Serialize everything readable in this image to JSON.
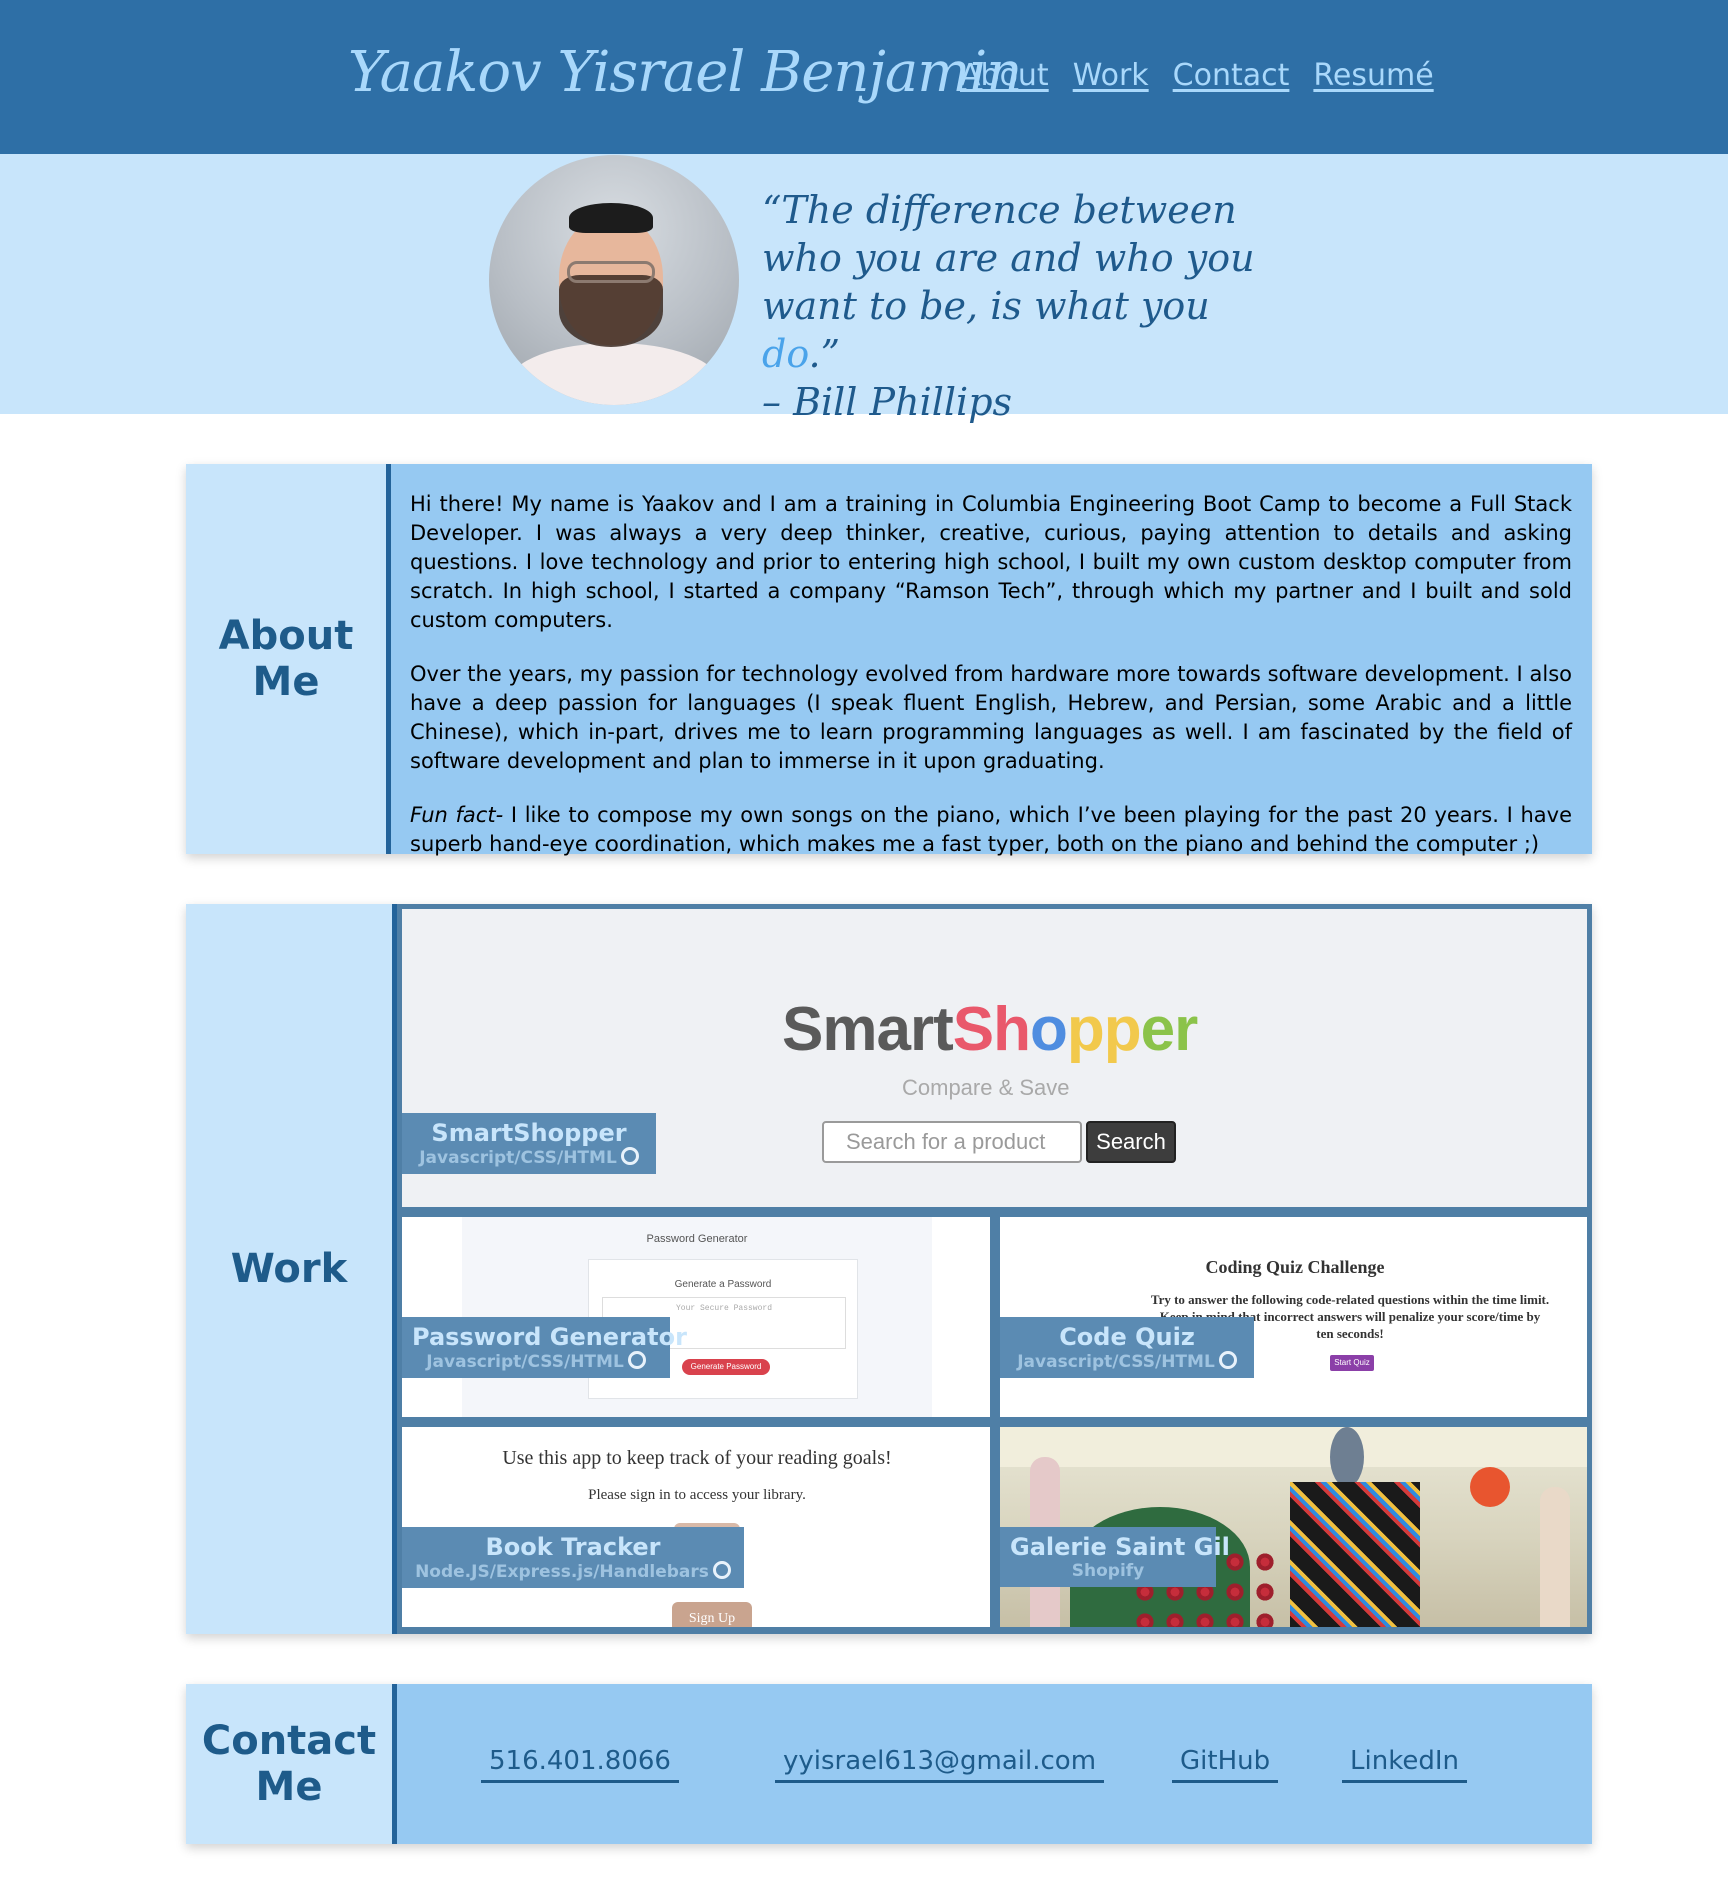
{
  "header": {
    "site_name": "Yaakov Yisrael Benjamin",
    "nav": [
      "About",
      "Work",
      "Contact",
      "Resumé"
    ]
  },
  "hero": {
    "quote_part1": "“The difference between who you are and who you want to be, is what you ",
    "quote_accent": "do",
    "quote_part2": ".”",
    "quote_author": "– Bill Phillips",
    "accent_color": "#4aa3ea"
  },
  "about": {
    "label_line1": "About",
    "label_line2": "Me",
    "para1": "Hi there! My name is Yaakov and I am a training in Columbia Engineering Boot Camp to become a Full Stack Developer. I was always a very deep thinker, creative, curious, paying attention to details and asking questions. I love technology and prior to entering high school, I built my own custom desktop computer from scratch. In high school, I started a company “Ramson Tech”, through which my partner and I built and sold custom computers.",
    "para2": "Over the years, my passion for technology evolved from hardware more towards software development. I also have a deep passion for languages (I speak fluent English, Hebrew, and Persian, some Arabic and a little Chinese), which in-part, drives me to learn programming languages as well. I am fascinated by the field of software development and plan to immerse in it upon graduating.",
    "para3_em": "Fun fact-",
    "para3_rest": " I like to compose my own songs on the piano, which I’ve been playing for the past 20 years. I have superb hand-eye coordination, which makes me a fast typer, both on the piano and behind the computer ;)"
  },
  "work": {
    "label": "Work",
    "projects": [
      {
        "title": "SmartShopper",
        "tech": "Javascript/CSS/HTML",
        "screenshot": {
          "logo_parts": [
            "Smart",
            "Sh",
            "o",
            "pp",
            "er"
          ],
          "tagline": "Compare & Save",
          "search_placeholder": "Search for a product",
          "search_button": "Search"
        }
      },
      {
        "title": "Password Generator",
        "tech": "Javascript/CSS/HTML",
        "screenshot": {
          "title": "Password Generator",
          "subtitle": "Generate a Password",
          "box_placeholder": "Your Secure Password",
          "button": "Generate Password"
        }
      },
      {
        "title": "Code Quiz",
        "tech": "Javascript/CSS/HTML",
        "screenshot": {
          "title": "Coding Quiz Challenge",
          "text": "Try to answer the following code-related questions within the time limit. Keep in mind that incorrect answers will penalize your score/time by ten seconds!",
          "button": "Start Quiz"
        }
      },
      {
        "title": "Book Tracker",
        "tech": "Node.JS/Express.js/Handlebars",
        "screenshot": {
          "line1": "Use this app to keep track of your reading goals!",
          "line2": "Please sign in to access your library.",
          "button": "Sign Up"
        }
      },
      {
        "title": "Galerie Saint Gil",
        "tech": "Shopify"
      }
    ]
  },
  "contact": {
    "label_line1": "Contact",
    "label_line2": "Me",
    "phone": "516.401.8066",
    "email": "yyisrael613@gmail.com",
    "github": "GitHub",
    "linkedin": "LinkedIn"
  },
  "colors": {
    "header_bg": "#2e6fa6",
    "light_blue": "#c8e5fb",
    "mid_blue": "#96c9f2",
    "dark_blue": "#1e5b8a",
    "tile_label_bg": "#5b8bb3"
  },
  "icons": [
    "github-icon"
  ]
}
